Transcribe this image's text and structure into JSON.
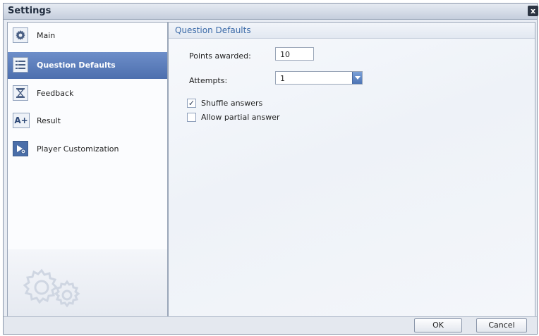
{
  "window": {
    "title": "Settings",
    "close_label": "x"
  },
  "sidebar": {
    "items": [
      {
        "label": "Main",
        "icon": "gear-icon"
      },
      {
        "label": "Question Defaults",
        "icon": "list-icon",
        "active": true
      },
      {
        "label": "Feedback",
        "icon": "hourglass-icon"
      },
      {
        "label": "Result",
        "icon": "grade-icon"
      },
      {
        "label": "Player Customization",
        "icon": "player-icon"
      }
    ],
    "grade_glyph": "A+"
  },
  "panel": {
    "title": "Question Defaults",
    "points_label": "Points awarded:",
    "points_value": "10",
    "attempts_label": "Attempts:",
    "attempts_value": "1",
    "shuffle_label": "Shuffle answers",
    "shuffle_checked": true,
    "partial_label": "Allow partial answer",
    "partial_checked": false
  },
  "footer": {
    "ok_label": "OK",
    "cancel_label": "Cancel"
  }
}
